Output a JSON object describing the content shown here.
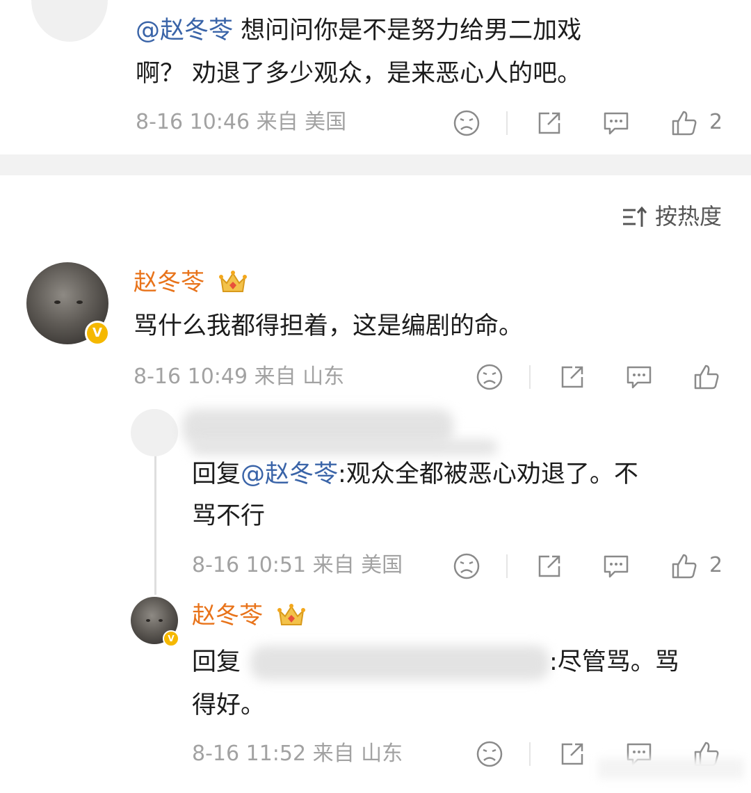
{
  "comment_top": {
    "mention": "@赵冬苓",
    "line1_rest": " 想问问你是不是努力给男二加戏",
    "line2": "啊？ 劝退了多少观众，是来恶心人的吧。",
    "meta": "8-16 10:46 来自 美国",
    "like_count": "2"
  },
  "sort": {
    "label": "按热度"
  },
  "comment_main": {
    "user": "赵冬苓",
    "text": "骂什么我都得担着，这是编剧的命。",
    "meta": "8-16 10:49 来自 山东",
    "verified": "V"
  },
  "reply_1": {
    "prefix": "回复",
    "mention": "@赵冬苓",
    "line1_rest": ":观众全都被恶心劝退了。不",
    "line2": "骂不行",
    "meta": "8-16 10:51 来自 美国",
    "like_count": "2"
  },
  "reply_2": {
    "user": "赵冬苓",
    "prefix": "回复",
    "line1_rest": ":尽管骂。骂",
    "line2": "得好。",
    "meta": "8-16 11:52 来自 山东",
    "verified": "V"
  },
  "colors": {
    "accent_name": "#e8731a",
    "mention": "#3a64a8",
    "meta": "#a2a2a2",
    "badge": "#f5b800"
  },
  "icons": [
    "sad-face-icon",
    "share-icon",
    "comment-icon",
    "like-icon",
    "sort-icon",
    "crown-icon"
  ]
}
